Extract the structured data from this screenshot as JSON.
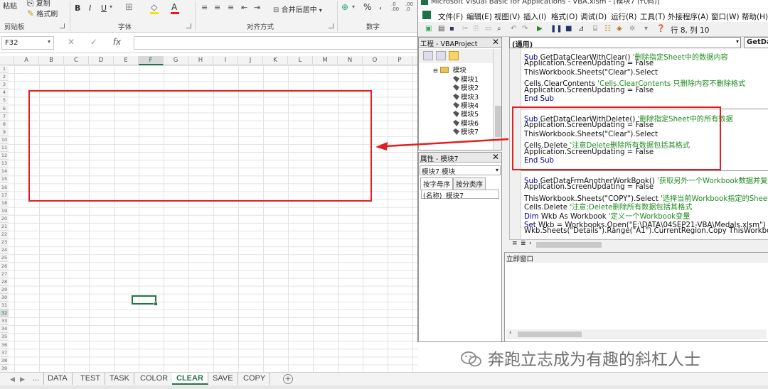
{
  "excel": {
    "ribbon": {
      "paste": "粘贴",
      "cut": "复制",
      "format_painter": "格式刷",
      "clipboard": "剪贴板",
      "font": "字体",
      "alignment": "对齐方式",
      "merge_center": "合并后居中",
      "number": "数字",
      "bold": "B",
      "italic": "I",
      "underline": "U",
      "font_color": "A",
      "percent": "%",
      "comma": ","
    },
    "formula_bar": {
      "name_box": "F32",
      "cancel": "✕",
      "enter": "✓",
      "fx": "fx",
      "value": ""
    },
    "columns": [
      "A",
      "B",
      "C",
      "D",
      "E",
      "F",
      "G",
      "H",
      "I",
      "J",
      "K",
      "L",
      "M",
      "N",
      "O",
      "P"
    ],
    "selected_column": "F",
    "rows": [
      "1",
      "2",
      "3",
      "4",
      "5",
      "6",
      "7",
      "8",
      "9",
      "10",
      "11",
      "12",
      "13",
      "14",
      "15",
      "16",
      "17",
      "18",
      "19",
      "20",
      "21",
      "22",
      "23",
      "24",
      "25",
      "26",
      "27",
      "28",
      "29",
      "30",
      "31",
      "32",
      "33",
      "34",
      "35",
      "36",
      "37",
      "38",
      "39"
    ],
    "selected_row": "32",
    "sheet_tabs": [
      "...",
      "DATA",
      "TEST",
      "TASK",
      "COLOR",
      "CLEAR",
      "SAVE",
      "COPY"
    ],
    "active_sheet": "CLEAR",
    "nav_prev": "◀",
    "nav_next": "▶",
    "add_sheet": "+"
  },
  "vba": {
    "title": "Microsoft Visual Basic for Applications - VBA.xlsm - [模块7 (代码)]",
    "menu": [
      "文件(F)",
      "编辑(E)",
      "视图(V)",
      "插入(I)",
      "格式(O)",
      "调试(D)",
      "运行(R)",
      "工具(T)",
      "外接程序(A)",
      "窗口(W)",
      "帮助(H)"
    ],
    "cursor_position": "行 8, 列 10",
    "project": {
      "title": "工程 - VBAProject",
      "close": "✕",
      "folder": "模块",
      "modules": [
        "模块1",
        "模块2",
        "模块3",
        "模块4",
        "模块5",
        "模块6",
        "模块7"
      ]
    },
    "properties": {
      "title": "属性 - 模块7",
      "close": "✕",
      "object": "模块7 模块",
      "tab_alpha": "按字母序",
      "tab_category": "按分类序",
      "name_key": "(名称)",
      "name_value": "模块7"
    },
    "code_header": {
      "object": "(通用)",
      "procedure": "GetDa"
    },
    "code": {
      "block1": [
        {
          "kw": "Sub ",
          "text": "GetDataClearWithClear() ",
          "cm": "'删除指定Sheet中的数据内容"
        },
        {
          "kw": "",
          "text": "Application.ScreenUpdating = False",
          "cm": ""
        },
        {
          "kw": "",
          "text": "ThisWorkbook.Sheets(\"Clear\").Select",
          "cm": ""
        },
        {
          "kw": "",
          "text": "Cells.ClearContents ",
          "cm": "'Cells.ClearContents 只删除内容不删除格式"
        },
        {
          "kw": "",
          "text": "Application.ScreenUpdating = False",
          "cm": ""
        },
        {
          "kw": "End Sub",
          "text": "",
          "cm": ""
        }
      ],
      "block2": [
        {
          "kw": "Sub ",
          "text": "GetDataClearWithDelete() ",
          "cm": "'删除指定Sheet中的所有数据"
        },
        {
          "kw": "",
          "text": "Application.ScreenUpdating = False",
          "cm": ""
        },
        {
          "kw": "",
          "text": "ThisWorkbook.Sheets(\"Clear\").Select",
          "cm": ""
        },
        {
          "kw": "",
          "text": "Cells.Delete ",
          "cm": "'注意Delete删除所有数据包括其格式"
        },
        {
          "kw": "",
          "text": "Application.ScreenUpdating = False",
          "cm": ""
        },
        {
          "kw": "End Sub",
          "text": "",
          "cm": ""
        }
      ],
      "block3": [
        {
          "kw": "Sub ",
          "text": "GetDataFrmAnotherWorkBook() ",
          "cm": "'获取另外一个Workbook数据并复制移动到"
        },
        {
          "kw": "",
          "text": "Application.ScreenUpdating = False",
          "cm": ""
        },
        {
          "kw": "",
          "text": "ThisWorkbook.Sheets(\"COPY\").Select ",
          "cm": "'选择当前Workbook指定的Sheet"
        },
        {
          "kw": "",
          "text": "Cells.Delete ",
          "cm": "'注意:Delete删除所有数据包括其格式"
        },
        {
          "kw": "Dim ",
          "text": "Wkb As Workbook ",
          "cm": "'定义一个Workbook变量"
        },
        {
          "kw": "Set ",
          "text": "Wkb = Workbooks.Open(\"E:\\DATA\\04SEP21-VBA\\Medals.xlsm\") ",
          "cm": "'打开指定"
        },
        {
          "kw": "",
          "text": "Wkb.Sheets(\"Details\").Range(\"A1\").CurrentRegion.Copy ThisWorkbook.Sheet",
          "cm": ""
        }
      ]
    },
    "immediate": {
      "title": "立即窗口"
    }
  },
  "watermark": {
    "text": "奔跑立志成为有趣的斜杠人士"
  },
  "colors": {
    "excel_green": "#217346",
    "highlight_red": "#e02020",
    "vba_keyword": "#00008b",
    "vba_comment": "#1f8b1f"
  }
}
